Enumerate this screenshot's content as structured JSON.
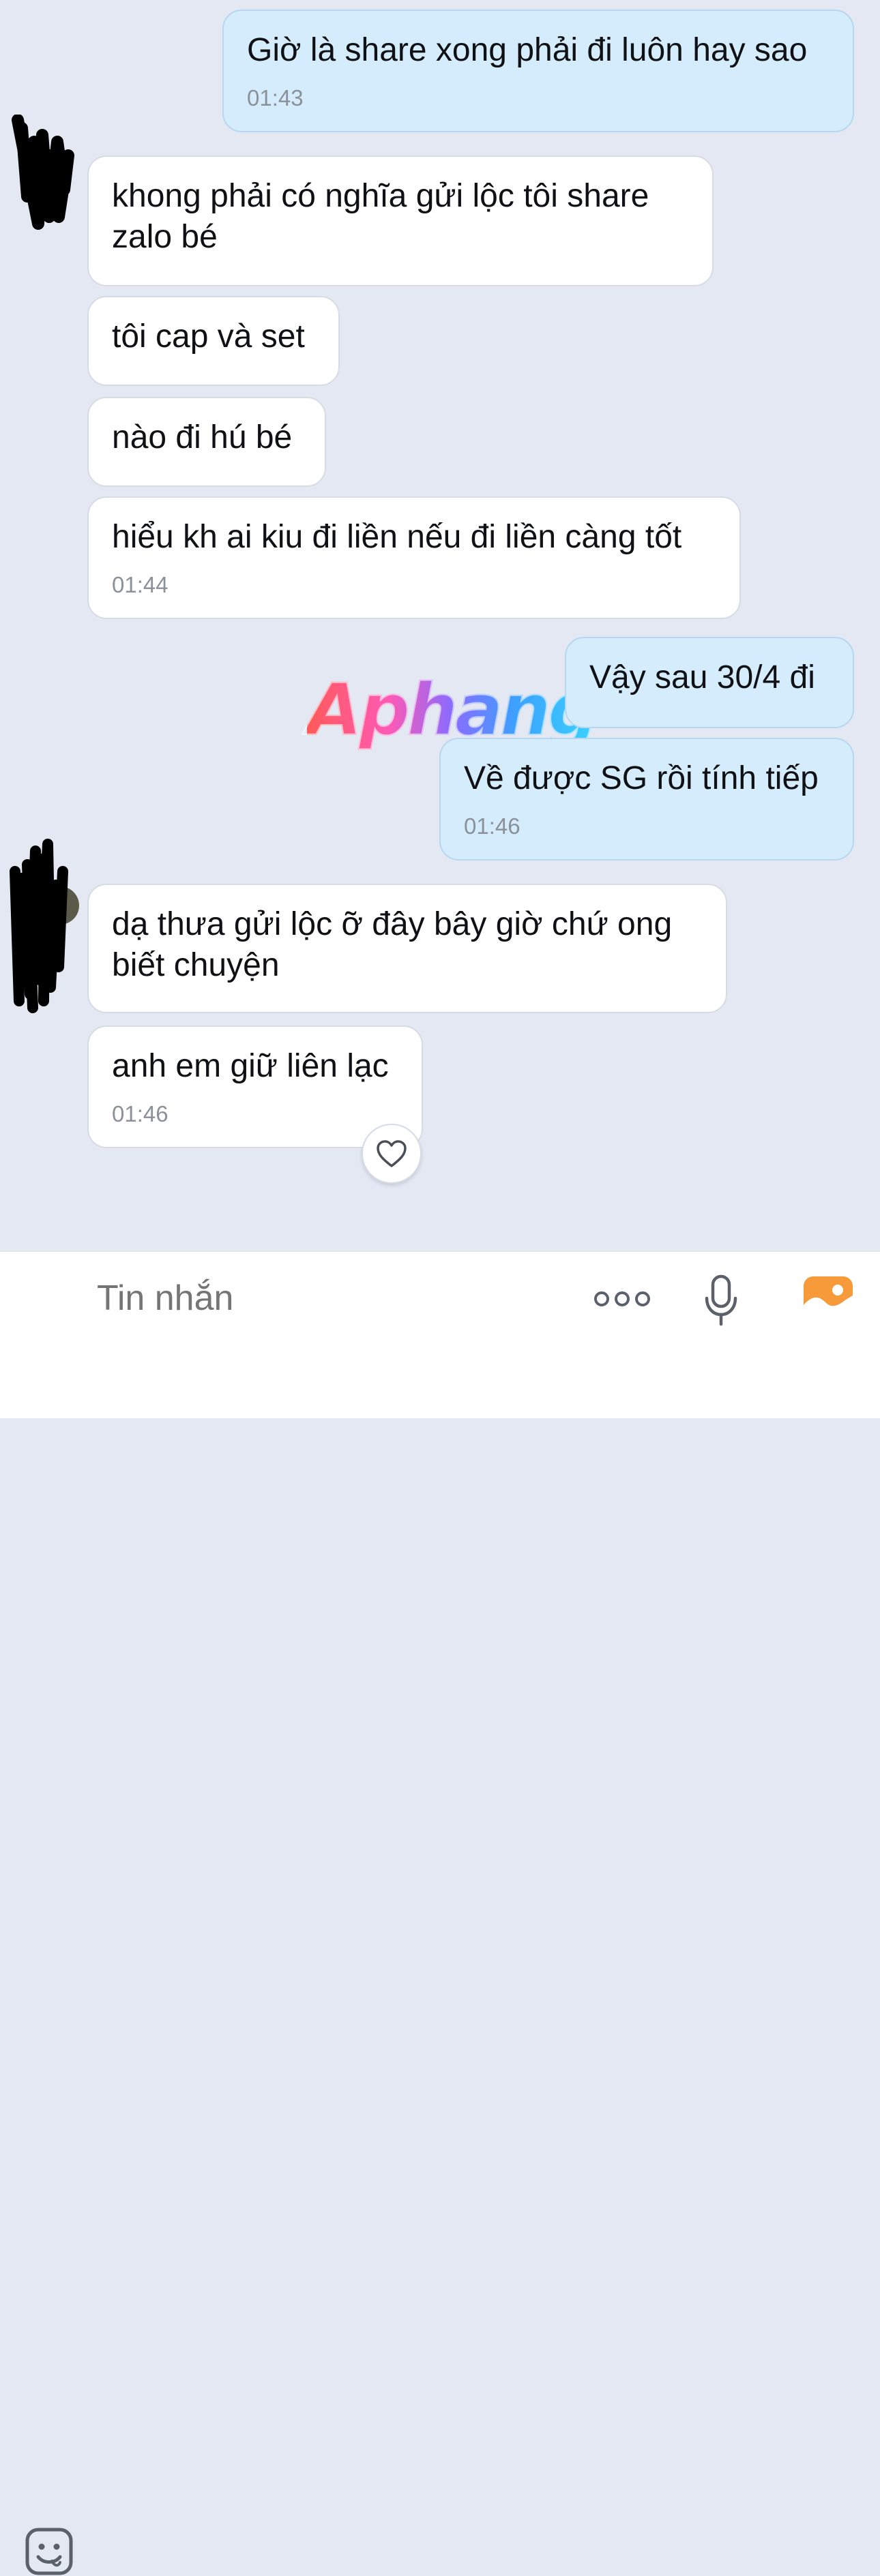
{
  "messages": [
    {
      "side": "out",
      "text": "Giờ là share xong phải đi luôn hay sao",
      "time": "01:43"
    },
    {
      "side": "in",
      "text": "khong phải có nghĩa gửi lộc tôi share zalo bé"
    },
    {
      "side": "in",
      "text": "tôi cap và set"
    },
    {
      "side": "in",
      "text": "nào đi hú bé"
    },
    {
      "side": "in",
      "text": "hiểu kh ai kiu đi liền nếu đi liền càng tốt",
      "time": "01:44"
    },
    {
      "side": "out",
      "text": "Vậy sau 30/4 đi"
    },
    {
      "side": "out",
      "text": "Về được SG rồi tính tiếp",
      "time": "01:46"
    },
    {
      "side": "in",
      "text": "dạ thưa gửi lộc ỡ đây bây giờ chứ ong biết chuyện"
    },
    {
      "side": "in",
      "text": "anh em giữ liên lạc",
      "time": "01:46"
    }
  ],
  "watermark": "Aphang",
  "reaction_icon": "heart-outline-icon",
  "input": {
    "placeholder": "Tin nhắn",
    "icons": [
      "emoji-sticker-icon",
      "more-options-icon",
      "microphone-icon",
      "image-gallery-icon"
    ]
  },
  "colors": {
    "background": "#e4e8f3",
    "bubble_in": "#ffffff",
    "bubble_out": "#d5ecfc",
    "time": "#8b9198",
    "gallery_icon": "#f79a3a"
  }
}
